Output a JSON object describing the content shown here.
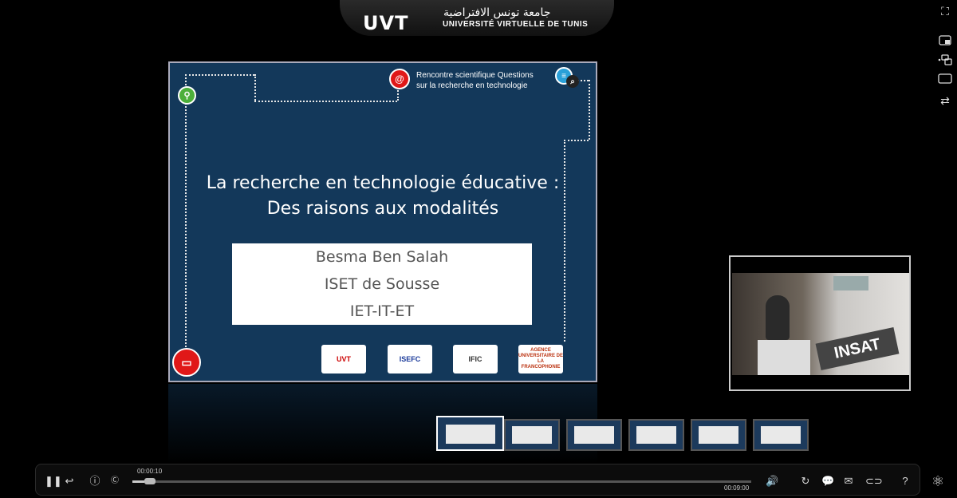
{
  "header": {
    "logo_text": "UVT",
    "arabic_name": "جامعة تونس الافتراضية",
    "french_name": "UNIVERSITÉ VIRTUELLE DE TUNIS"
  },
  "slide": {
    "top_note_line1": "Rencontre scientifique Questions",
    "top_note_line2": "sur la recherche en technologie",
    "title_line1": "La recherche en technologie éducative :",
    "title_line2": "Des raisons aux modalités",
    "author": "Besma Ben Salah",
    "institution": "ISET de Sousse",
    "department": "IET-IT-ET",
    "logos": [
      "UVT",
      "ISEFC",
      "IFIC",
      "AGENCE UNIVERSITAIRE DE LA FRANCOPHONIE"
    ]
  },
  "video": {
    "banner": "INSAT"
  },
  "thumbnails": {
    "count": 6,
    "selected_index": 0
  },
  "player": {
    "current_time": "00:00:10",
    "total_time": "00:09:00",
    "progress_fraction": 0.019
  },
  "icons": {
    "fullscreen": "fullscreen-icon",
    "pip": "picture-in-picture-icon",
    "layout": "layout-icon",
    "screen": "screen-icon",
    "swap": "swap-icon"
  }
}
